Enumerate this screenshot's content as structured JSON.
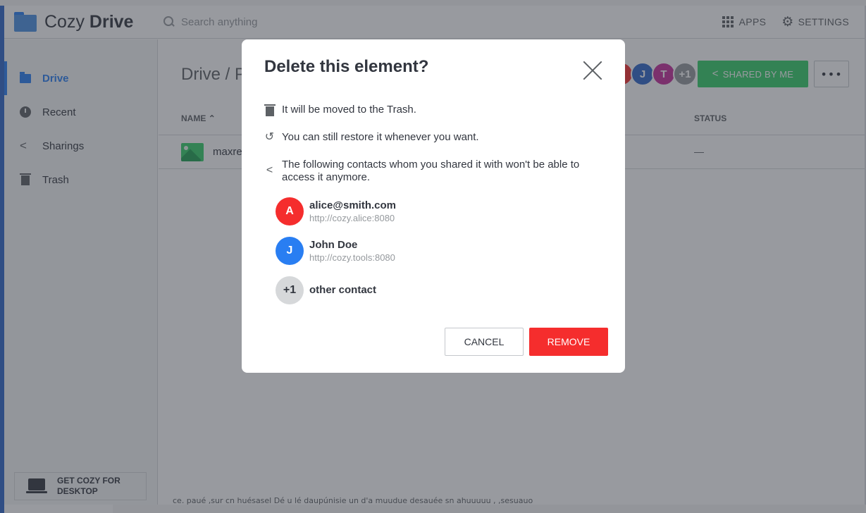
{
  "app": {
    "name_light": "Cozy",
    "name_bold": "Drive"
  },
  "search": {
    "placeholder": "Search anything"
  },
  "header": {
    "apps_label": "APPS",
    "settings_label": "SETTINGS"
  },
  "sidebar": {
    "items": [
      {
        "label": "Drive",
        "icon": "folder-icon",
        "active": true
      },
      {
        "label": "Recent",
        "icon": "clock-icon"
      },
      {
        "label": "Sharings",
        "icon": "share-icon"
      },
      {
        "label": "Trash",
        "icon": "trash-icon"
      }
    ],
    "desktop_promo": {
      "line1": "GET COZY FOR",
      "line2": "DESKTOP"
    }
  },
  "main": {
    "breadcrumb": "Drive / P",
    "shared_avatars": [
      {
        "initial": "",
        "color": "#f52d2d"
      },
      {
        "initial": "J",
        "color": "#2f66c8"
      },
      {
        "initial": "T",
        "color": "#c52d9a"
      },
      {
        "initial": "+1",
        "color": "#95999d"
      }
    ],
    "shared_button": "SHARED BY ME",
    "more_button": "•••",
    "columns": {
      "name": "NAME",
      "status": "STATUS"
    },
    "rows": [
      {
        "name": "maxre",
        "status": "—"
      }
    ],
    "bottom_text": "ce. paué ,sur cn huésasel Dé u lé daupúnisie un d'a muudue desauée sn ahuuuuu , ,sesuauo"
  },
  "modal": {
    "title": "Delete this element?",
    "info": [
      "It will be moved to the Trash.",
      "You can still restore it whenever you want.",
      "The following contacts whom you shared it with won't be able to access it anymore."
    ],
    "contacts": [
      {
        "initial": "A",
        "name": "alice@smith.com",
        "url": "http://cozy.alice:8080",
        "color": "#f52d2d"
      },
      {
        "initial": "J",
        "name": "John Doe",
        "url": "http://cozy.tools:8080",
        "color": "#297ef2"
      },
      {
        "initial": "+1",
        "name": "other contact",
        "url": "",
        "color": "#d6d8da"
      }
    ],
    "cancel_label": "CANCEL",
    "remove_label": "REMOVE"
  },
  "colors": {
    "accent": "#297ef2",
    "danger": "#f52d2d",
    "success": "#35ce68"
  }
}
